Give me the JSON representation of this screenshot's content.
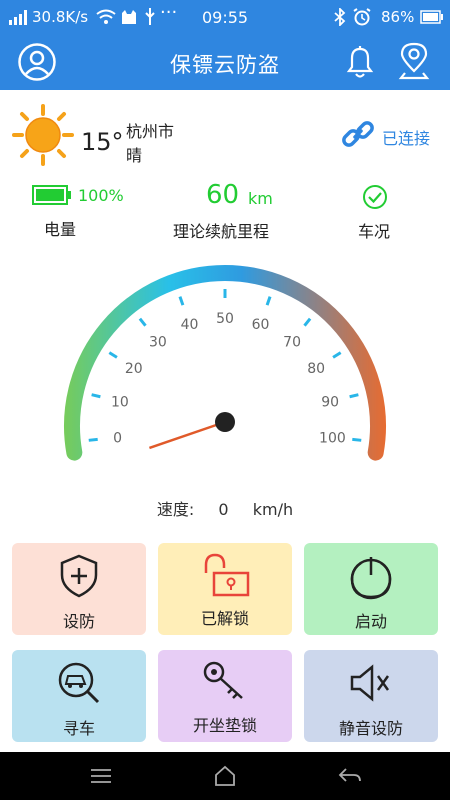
{
  "status_bar": {
    "network_speed": "30.8K/s",
    "time": "09:55",
    "battery_percent": "86%",
    "icons": [
      "signal-icon",
      "wifi-icon",
      "cat-icon",
      "usb-icon",
      "more-icon",
      "bluetooth-icon",
      "alarm-icon",
      "battery-icon"
    ]
  },
  "app_bar": {
    "title": "保镖云防盗",
    "icons": [
      "profile-icon",
      "bell-icon",
      "location-pin-icon"
    ]
  },
  "weather": {
    "temperature": "15°",
    "city": "杭州市",
    "condition": "晴",
    "icon": "sun-icon"
  },
  "connection": {
    "label": "已连接",
    "icon": "link-icon",
    "color": "#2f86e0"
  },
  "stats": {
    "battery_value": "100%",
    "battery_label": "电量",
    "range_value": "60",
    "range_unit": "km",
    "range_label": "理论续航里程",
    "condition_label": "车况",
    "accent_green": "#22cc33"
  },
  "gauge": {
    "ticks": [
      "0",
      "10",
      "20",
      "30",
      "40",
      "50",
      "60",
      "70",
      "80",
      "90",
      "100"
    ],
    "min": 0,
    "max": 100,
    "current_value": 0,
    "gradient_colors": [
      "#7acc55",
      "#29c0e8",
      "#2f9be0",
      "#ec6a2c"
    ]
  },
  "speed_display": {
    "label": "速度:",
    "value": "0",
    "unit": "km/h"
  },
  "tiles": [
    {
      "label": "设防",
      "icon": "shield-plus-icon",
      "color": "#fde0d6"
    },
    {
      "label": "已解锁",
      "icon": "unlocked-padlock-icon",
      "color": "#ffeeb8"
    },
    {
      "label": "启动",
      "icon": "power-icon",
      "color": "#b4f0c0"
    },
    {
      "label": "寻车",
      "icon": "find-vehicle-icon",
      "color": "#b9e1f0"
    },
    {
      "label": "开坐垫锁",
      "icon": "key-icon",
      "color": "#e7cdf5"
    },
    {
      "label": "静音设防",
      "icon": "mute-speaker-icon",
      "color": "#ccd7ec"
    }
  ],
  "nav_bar": {
    "icons": [
      "menu-icon",
      "home-icon",
      "back-icon"
    ]
  }
}
